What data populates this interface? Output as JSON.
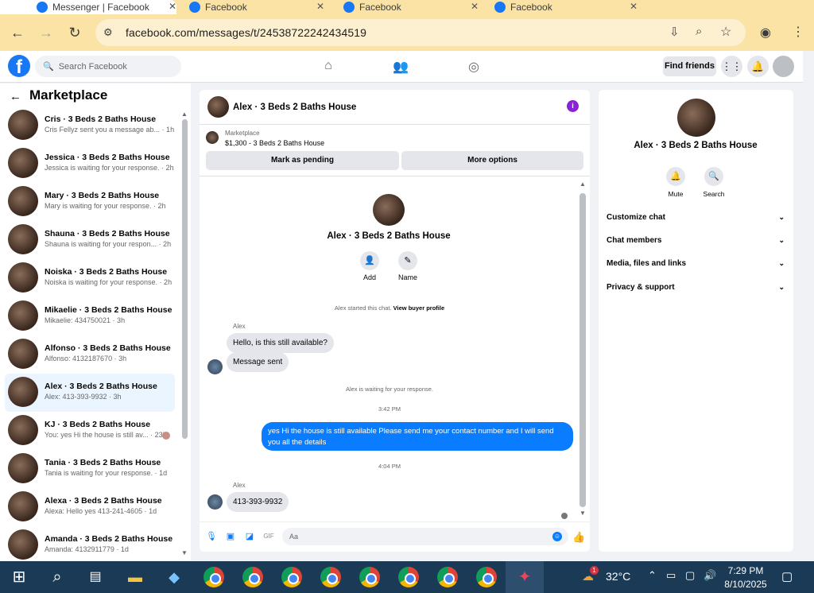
{
  "browser": {
    "tabs": [
      {
        "label": "Messenger | Facebook"
      },
      {
        "label": "Facebook"
      },
      {
        "label": "Facebook"
      },
      {
        "label": "Facebook"
      }
    ],
    "url": "facebook.com/messages/t/24538722242434519"
  },
  "fbnav": {
    "search_placeholder": "Search Facebook",
    "find_friends": "Find friends"
  },
  "sidebar": {
    "title": "Marketplace",
    "chats": [
      {
        "name": "Cris · 3 Beds 2 Baths House",
        "preview": "Cris Fellyz sent you a message ab... · 1h"
      },
      {
        "name": "Jessica · 3 Beds 2 Baths House",
        "preview": "Jessica is waiting for your response. · 2h"
      },
      {
        "name": "Mary · 3 Beds 2 Baths House",
        "preview": "Mary is waiting for your response. · 2h"
      },
      {
        "name": "Shauna · 3 Beds 2 Baths House",
        "preview": "Shauna is waiting for your respon... · 2h"
      },
      {
        "name": "Noiska · 3 Beds 2 Baths House",
        "preview": "Noiska is waiting for your response. · 2h"
      },
      {
        "name": "Mikaelie · 3 Beds 2 Baths House",
        "preview": "Mikaelie: 434750021 · 3h"
      },
      {
        "name": "Alfonso · 3 Beds 2 Baths House",
        "preview": "Alfonso: 4132187670 · 3h"
      },
      {
        "name": "Alex · 3 Beds 2 Baths House",
        "preview": "Alex: 413-393-9932 · 3h"
      },
      {
        "name": "KJ · 3 Beds 2 Baths House",
        "preview": "You: yes Hi the house is still av... · 23h"
      },
      {
        "name": "Tania · 3 Beds 2 Baths House",
        "preview": "Tania is waiting for your response. · 1d"
      },
      {
        "name": "Alexa · 3 Beds 2 Baths House",
        "preview": "Alexa: Hello yes 413-241-4605 · 1d"
      },
      {
        "name": "Amanda · 3 Beds 2 Baths House",
        "preview": "Amanda: 4132911779 · 1d"
      }
    ]
  },
  "conversation": {
    "title": "Alex · 3 Beds 2 Baths House",
    "marketplace_label": "Marketplace",
    "listing": "$1,300 - 3 Beds 2 Baths House",
    "mark_pending": "Mark as pending",
    "more_options": "More options",
    "profile_name": "Alex · 3 Beds 2 Baths House",
    "add_label": "Add",
    "name_label": "Name",
    "started_text": "Alex started this chat.",
    "view_profile": "View buyer profile",
    "sender1": "Alex",
    "msg1": "Hello, is this still available?",
    "msg2": "Message sent",
    "waiting": "Alex is waiting for your response.",
    "time1": "3:42 PM",
    "my_msg": "yes Hi the house is still available Please send me your contact number and I will send you all the details",
    "time2": "4:04 PM",
    "sender2": "Alex",
    "msg3": "413-393-9932",
    "input_placeholder": "Aa"
  },
  "details": {
    "name": "Alex · 3 Beds 2 Baths House",
    "mute": "Mute",
    "search": "Search",
    "rows": [
      "Customize chat",
      "Chat members",
      "Media, files and links",
      "Privacy & support"
    ]
  },
  "taskbar": {
    "temperature": "32°C",
    "time": "7:29 PM",
    "date": "8/10/2025",
    "weather_badge": "1"
  },
  "colors": {
    "accent": "#0a7cff",
    "facebook_blue": "#1877f2",
    "chrome_bar": "#fbe3a6"
  }
}
